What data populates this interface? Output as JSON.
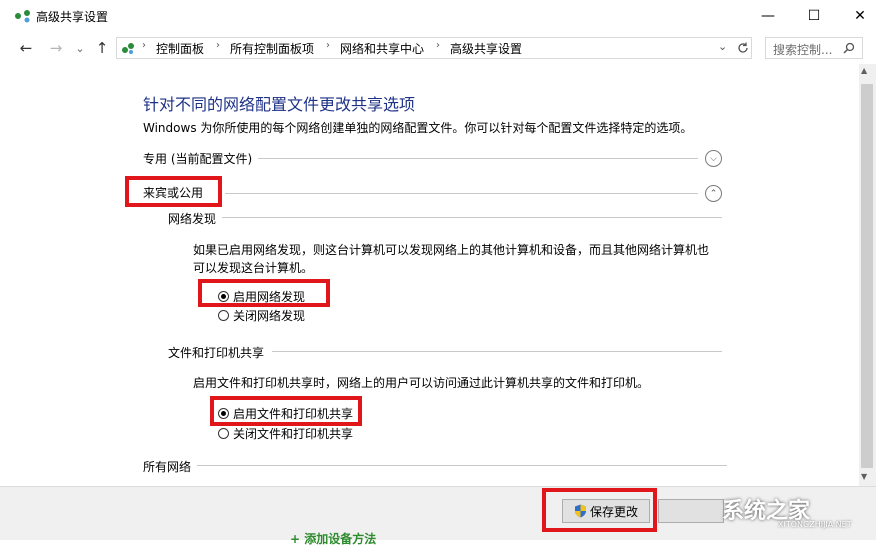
{
  "window": {
    "title": "高级共享设置",
    "minimize_glyph": "—",
    "maximize_glyph": "☐",
    "close_glyph": "✕"
  },
  "nav": {
    "back": "←",
    "forward": "→",
    "recent": "⌄",
    "up": "↑",
    "breadcrumbs": [
      "控制面板",
      "所有控制面板项",
      "网络和共享中心",
      "高级共享设置"
    ],
    "search_placeholder": "搜索控制...",
    "search_icon": "search-icon",
    "refresh_icon": "refresh-icon"
  },
  "content": {
    "heading": "针对不同的网络配置文件更改共享选项",
    "description": "Windows 为你所使用的每个网络创建单独的网络配置文件。你可以针对每个配置文件选择特定的选项。",
    "profiles": {
      "private": "专用 (当前配置文件)",
      "guest_public": "来宾或公用",
      "all_networks": "所有网络"
    },
    "network_discovery": {
      "title": "网络发现",
      "text_line1": "如果已启用网络发现，则这台计算机可以发现网络上的其他计算机和设备，而且其他网络计算机也",
      "text_line2": "可以发现这台计算机。",
      "option_on": "启用网络发现",
      "option_off": "关闭网络发现",
      "selected": "on"
    },
    "file_printer_sharing": {
      "title": "文件和打印机共享",
      "text": "启用文件和打印机共享时，网络上的用户可以访问通过此计算机共享的文件和打印机。",
      "option_on": "启用文件和打印机共享",
      "option_off": "关闭文件和打印机共享",
      "selected": "on"
    }
  },
  "footer": {
    "save_label": "保存更改"
  },
  "watermark": {
    "text": "系统之家",
    "sub": "XITONGZHIJIA.NET"
  },
  "below_window_text": "+ 添加设备方法",
  "colors": {
    "heading": "#1e3287",
    "highlight": "#e0161b"
  }
}
